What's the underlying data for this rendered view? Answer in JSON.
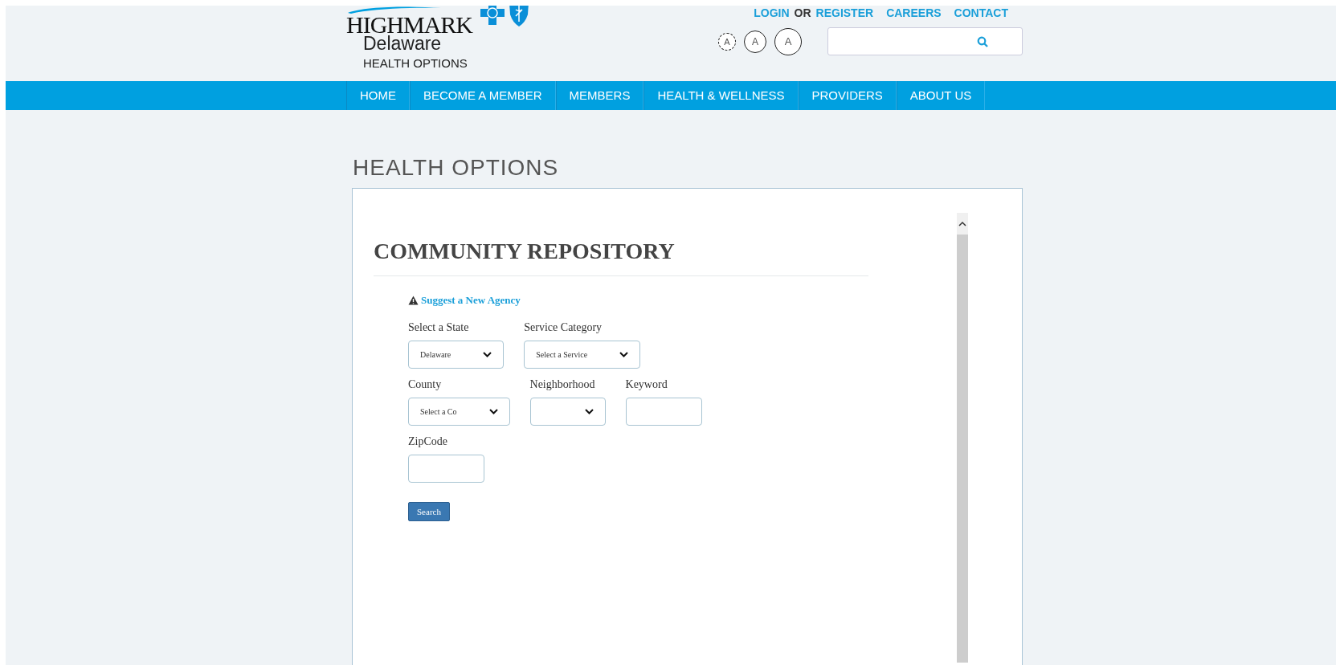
{
  "header": {
    "logo": {
      "brand": "HIGHMARK",
      "region": "Delaware",
      "tagline": "HEALTH OPTIONS"
    },
    "top_links": [
      {
        "label": "LOGIN",
        "kind": "link"
      },
      {
        "label": "OR",
        "kind": "text"
      },
      {
        "label": "REGISTER",
        "kind": "link"
      },
      {
        "label": "CAREERS",
        "kind": "link"
      },
      {
        "label": "CONTACT",
        "kind": "link"
      }
    ],
    "font_size_buttons": [
      "A",
      "A",
      "A"
    ]
  },
  "nav": [
    "HOME",
    "BECOME A MEMBER",
    "MEMBERS",
    "HEALTH & WELLNESS",
    "PROVIDERS",
    "ABOUT US"
  ],
  "page_title": "HEALTH OPTIONS",
  "repository": {
    "title": "COMMUNITY REPOSITORY",
    "suggest_link": "Suggest a New Agency",
    "rows": [
      [
        {
          "label": "Select a State",
          "kind": "select",
          "value": "Delaware"
        },
        {
          "label": "Service Category",
          "kind": "select",
          "value": "Select a Service"
        }
      ],
      [
        {
          "label": "County",
          "kind": "select",
          "value": "Select a Co"
        },
        {
          "label": "Neighborhood",
          "kind": "select"
        },
        {
          "label": "Keyword",
          "kind": "text"
        }
      ],
      [
        {
          "label": "ZipCode",
          "kind": "text"
        }
      ]
    ],
    "search_button": "Search"
  }
}
